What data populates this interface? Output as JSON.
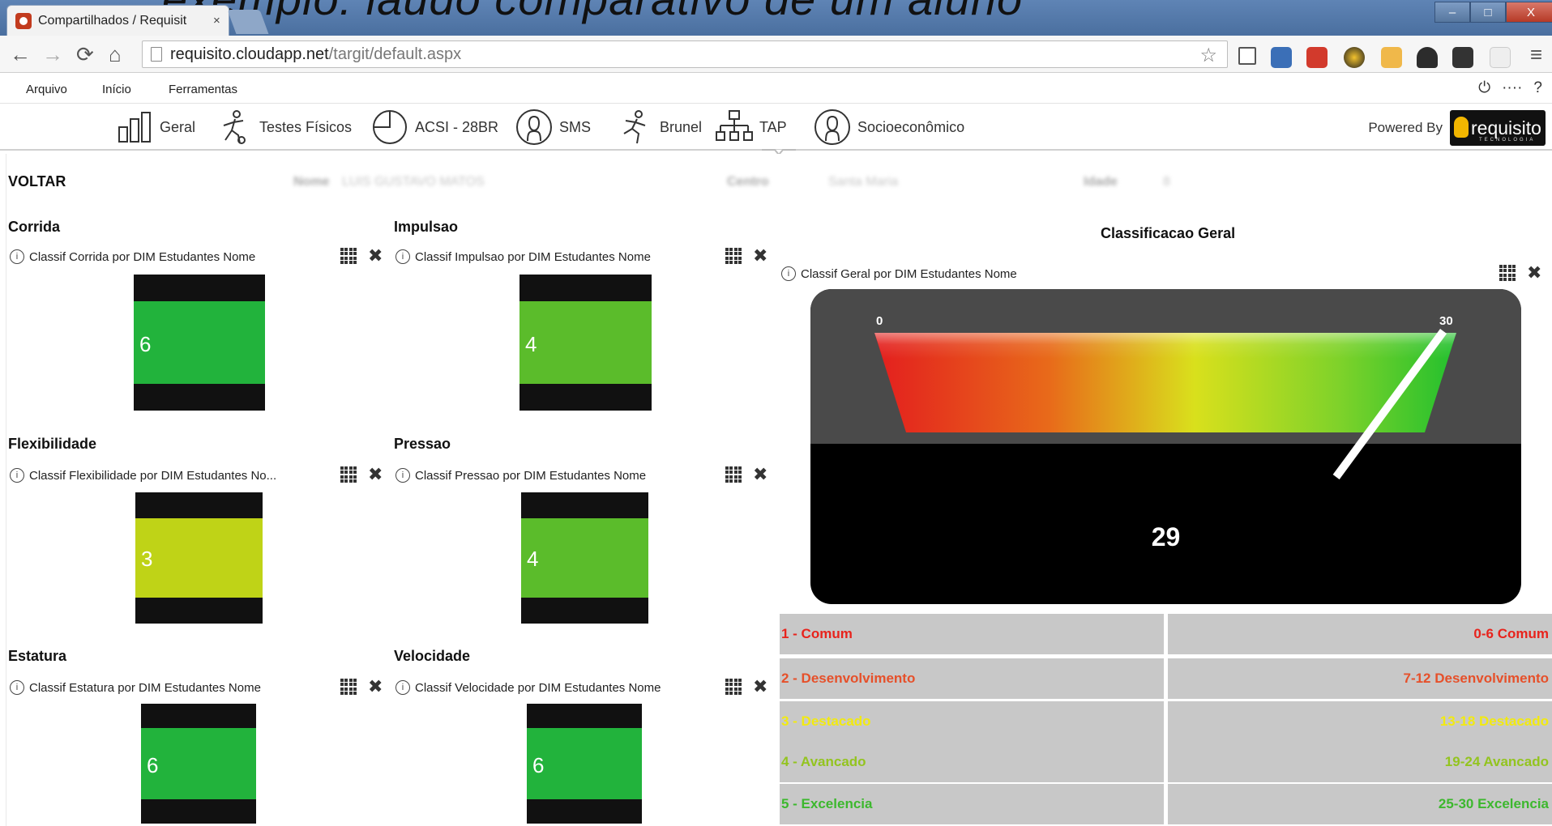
{
  "overlay_caption": "exemplo: laudo comparativo de um aluno",
  "browser": {
    "tab_title": "Compartilhados / Requisit",
    "tab_close": "×",
    "url_domain": "requisito.cloudapp.net",
    "url_path": "/targit/default.aspx",
    "win_minimize": "–",
    "win_maximize": "□",
    "win_close": "X"
  },
  "menu": {
    "arquivo": "Arquivo",
    "inicio": "Início",
    "ferramentas": "Ferramentas"
  },
  "nav": {
    "geral": "Geral",
    "testes": "Testes Físicos",
    "acsi": "ACSI - 28BR",
    "sms": "SMS",
    "brunel": "Brunel",
    "tap": "TAP",
    "socio": "Socioeconômico",
    "powered_by": "Powered By",
    "logo_text": "requisito",
    "logo_sub": "TECNOLOGIA"
  },
  "header": {
    "back": "VOLTAR",
    "nome_label": "Nome",
    "nome_value": "LUIS GUSTAVO MATOS",
    "centro_label": "Centro",
    "centro_value": "Santa Maria",
    "idade_label": "Idade",
    "idade_value": "8"
  },
  "widgets": [
    {
      "title": "Corrida",
      "subtitle": "Classif Corrida por DIM Estudantes Nome",
      "value": "6",
      "color": "#22b33c"
    },
    {
      "title": "Impulsao",
      "subtitle": "Classif Impulsao por DIM Estudantes Nome",
      "value": "4",
      "color": "#5bbc2b"
    },
    {
      "title": "Flexibilidade",
      "subtitle": "Classif Flexibilidade por DIM Estudantes No...",
      "value": "3",
      "color": "#bfd317"
    },
    {
      "title": "Pressao",
      "subtitle": "Classif Pressao por DIM Estudantes Nome",
      "value": "4",
      "color": "#5bbc2b"
    },
    {
      "title": "Estatura",
      "subtitle": "Classif Estatura por DIM Estudantes Nome",
      "value": "6",
      "color": "#22b33c"
    },
    {
      "title": "Velocidade",
      "subtitle": "Classif Velocidade por DIM Estudantes Nome",
      "value": "6",
      "color": "#22b33c"
    }
  ],
  "gauge": {
    "title": "Classificacao Geral",
    "subtitle": "Classif Geral por DIM Estudantes Nome",
    "min_label": "0",
    "max_label": "30",
    "value": 29,
    "value_text": "29"
  },
  "legend": [
    {
      "left": "1 - Comum",
      "right": "0-6 Comum",
      "color": "#e8231c"
    },
    {
      "left": "2 - Desenvolvimento",
      "right": "7-12 Desenvolvimento",
      "color": "#e6502a"
    },
    {
      "left": "3 - Destacado",
      "right": "13-18 Destacado",
      "color": "#f2ea10"
    },
    {
      "left": "4 - Avancado",
      "right": "19-24 Avancado",
      "color": "#93c41f"
    },
    {
      "left": "5 - Excelencia",
      "right": "25-30 Excelencia",
      "color": "#3db82e"
    }
  ],
  "icons": {
    "info": "i",
    "close": "✖",
    "star": "☆",
    "menu": "≡",
    "help": "?",
    "power": "⏻"
  }
}
